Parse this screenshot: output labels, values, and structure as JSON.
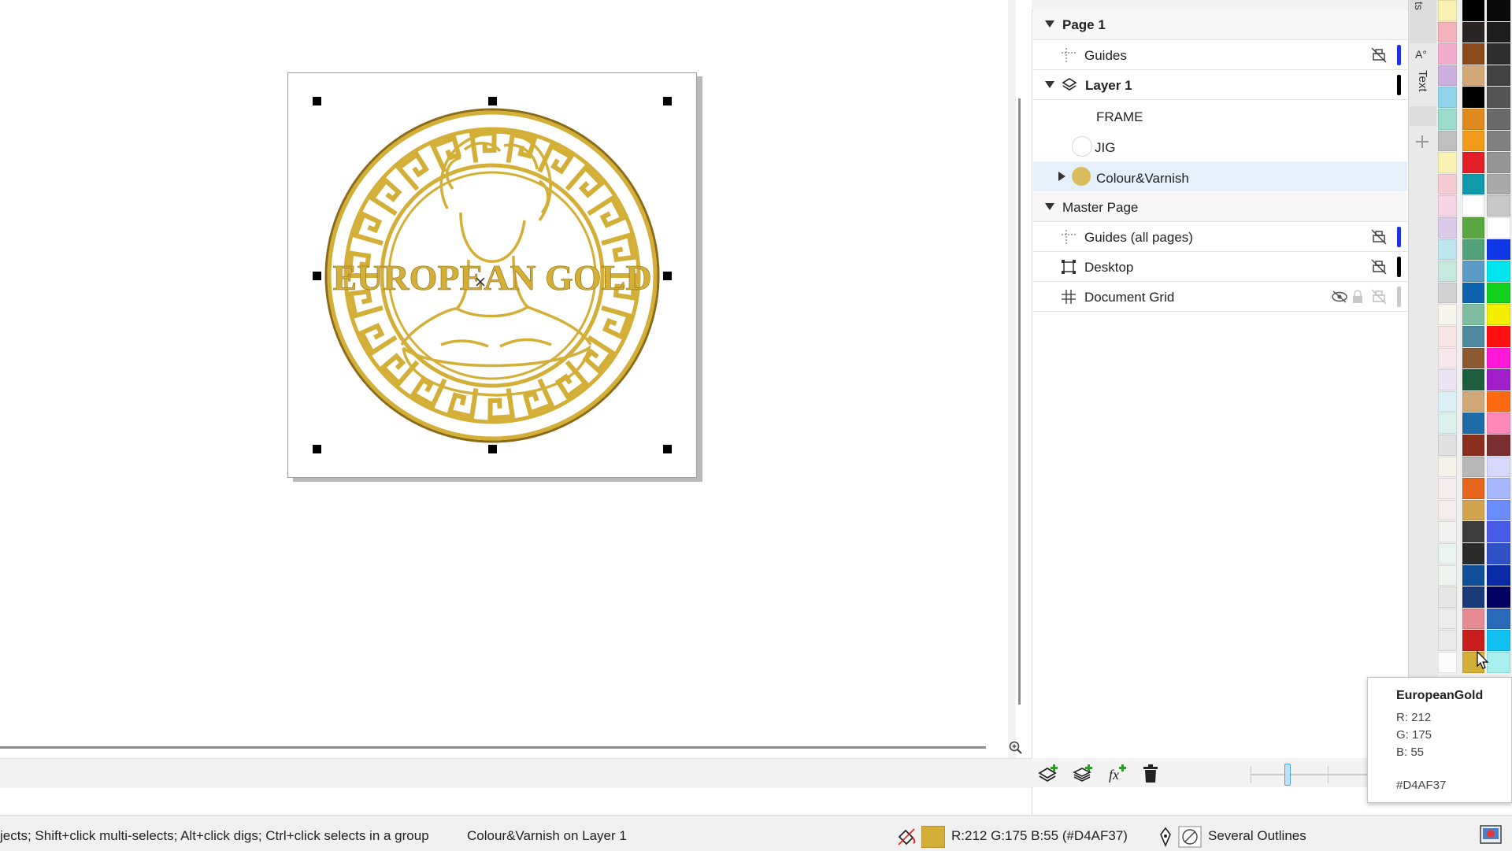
{
  "canvas": {
    "artwork": {
      "text": "EUROPEAN GOLD",
      "fill_color": "#D4AF37",
      "outline_color": "#8a6a14"
    }
  },
  "objects_panel": {
    "rows": [
      {
        "label": "Page 1",
        "kind": "page",
        "expanded": true
      },
      {
        "label": "Guides",
        "kind": "guides",
        "bar_color": "#1e2fe6"
      },
      {
        "label": "Layer 1",
        "kind": "layer",
        "expanded": true,
        "bar_color": "#000000"
      },
      {
        "label": "FRAME",
        "kind": "object"
      },
      {
        "label": "JIG",
        "kind": "object"
      },
      {
        "label": "Colour&Varnish",
        "kind": "group",
        "expanded": false,
        "selected": true
      },
      {
        "label": "Master Page",
        "kind": "page",
        "expanded": true
      },
      {
        "label": "Guides (all pages)",
        "kind": "guides",
        "bar_color": "#1e2fe6"
      },
      {
        "label": "Desktop",
        "kind": "desktop",
        "bar_color": "#000000"
      },
      {
        "label": "Document Grid",
        "kind": "grid",
        "bar_color": "#c8c8c8"
      }
    ]
  },
  "side_tabs": {
    "text_tab": "Text",
    "top_tab": "ts"
  },
  "palette": {
    "col1": [
      "#fbf3a8",
      "#f6a9b3",
      "#f4a2c9",
      "#c8a5dd",
      "#7fd0ea",
      "#8fd8c8",
      "#b7b7b7",
      "#fbf3a8",
      "#f6c6d0",
      "#f8d0e4",
      "#d9c4ea",
      "#b5e4f1",
      "#bfe8dd",
      "#cfcfcf",
      "#f8f8ec",
      "#fbe4e4",
      "#fbe6ee",
      "#ece2f4",
      "#d8f1f8",
      "#d9f2ec",
      "#dedede",
      "#f8f4e9",
      "#f6eded",
      "#f7eded",
      "#f3f3f3",
      "#e8f4f1",
      "#f1f5f1",
      "#e4e4e4",
      "#ececec",
      "#e9e9e9",
      "#ffffff"
    ],
    "col2": [
      "#000000",
      "#2b2424",
      "#8b4a1c",
      "#d2a878",
      "#000000",
      "#e08a1e",
      "#f29b1a",
      "#e21f26",
      "#0e9aaa",
      "#ffffff",
      "#5aa640",
      "#53a27a",
      "#5b9bc8",
      "#0e63ae",
      "#80bda0",
      "#4f8aa0",
      "#8c5a32",
      "#1f5e3c",
      "#d0a878",
      "#1f6aa8",
      "#8a2e1e",
      "#b8b8b8",
      "#e8651e",
      "#d2a34e",
      "#3c3c3c",
      "#2a2a2a",
      "#0e4f98",
      "#1a3a7a",
      "#e88a92",
      "#c81e1e",
      "#D4AF37"
    ],
    "col3": [
      "#0a0a0a",
      "#1e1e1e",
      "#2e2e2e",
      "#424242",
      "#555555",
      "#6a6a6a",
      "#808080",
      "#959595",
      "#aaaaaa",
      "#c8c8c8",
      "#ffffff",
      "#1038e8",
      "#00e5f0",
      "#12d11e",
      "#f4ee00",
      "#ff1010",
      "#ff18d8",
      "#a01ecc",
      "#ff6a10",
      "#ff88b8",
      "#7a2e2e",
      "#d8d8ff",
      "#a8b8ff",
      "#6a8cff",
      "#4a5ae8",
      "#3050c8",
      "#0a2aa8",
      "#000060",
      "#2a6ab8",
      "#10c0f0",
      "#a8f0f0"
    ]
  },
  "tooltip": {
    "name": "EuropeanGold",
    "r": "R: 212",
    "g": "G: 175",
    "b": "B: 55",
    "hex": "#D4AF37"
  },
  "status_bar": {
    "hint": "jects; Shift+click multi-selects; Alt+click digs; Ctrl+click selects in a group",
    "selection": "Colour&Varnish on Layer 1",
    "fill_swatch": "#D4AF37",
    "fill_value": "R:212 G:175 B:55 (#D4AF37)",
    "outline_value": "Several Outlines"
  }
}
